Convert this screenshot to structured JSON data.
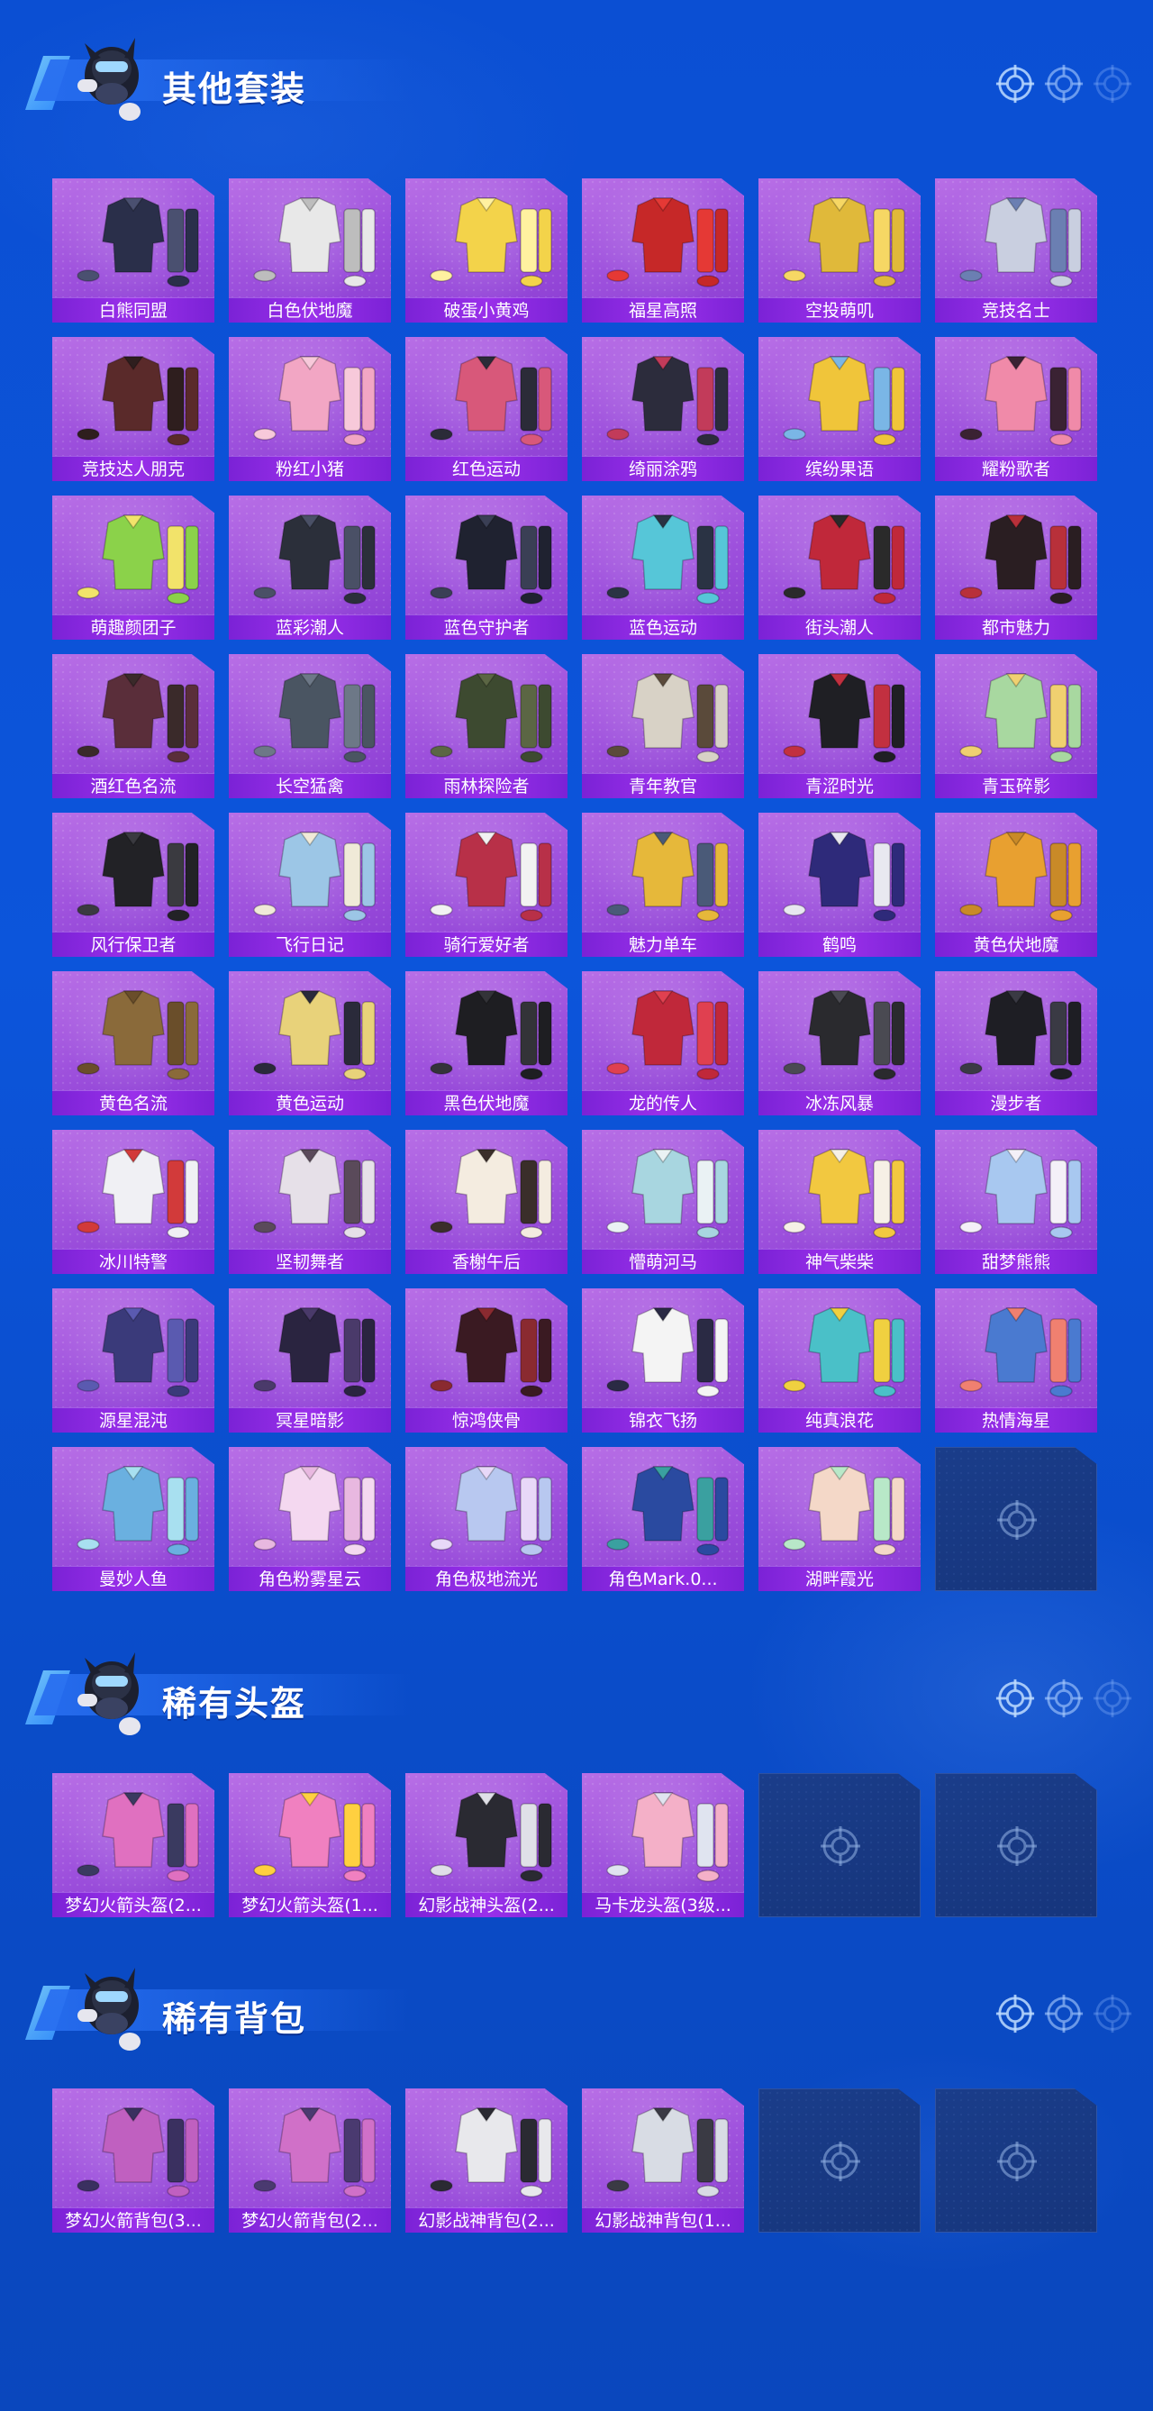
{
  "colors": {
    "page_bg": "#0d55d6",
    "card_purple": "#9c4fdc",
    "label_bar": "#8a2be2",
    "empty_slot": "#1a3d8a"
  },
  "sections": [
    {
      "title": "其他套装",
      "items": [
        {
          "label": "白熊同盟",
          "palette": [
            "#2a2f4a",
            "#4a5070"
          ]
        },
        {
          "label": "白色伏地魔",
          "palette": [
            "#e8e8e8",
            "#bdbdbd"
          ]
        },
        {
          "label": "破蛋小黄鸡",
          "palette": [
            "#f3d34a",
            "#fff1a0"
          ]
        },
        {
          "label": "福星高照",
          "palette": [
            "#c62828",
            "#e53935"
          ]
        },
        {
          "label": "空投萌叽",
          "palette": [
            "#e0b93a",
            "#f6d764"
          ]
        },
        {
          "label": "竞技名士",
          "palette": [
            "#c9cfe0",
            "#6b7fb2"
          ]
        },
        {
          "label": "竞技达人朋克",
          "palette": [
            "#5a2a2a",
            "#2e1e1e"
          ]
        },
        {
          "label": "粉红小猪",
          "palette": [
            "#f2a6c4",
            "#f7c9da"
          ]
        },
        {
          "label": "红色运动",
          "palette": [
            "#d8587a",
            "#2b2b38"
          ]
        },
        {
          "label": "绮丽涂鸦",
          "palette": [
            "#2c2c3c",
            "#c23b5a"
          ]
        },
        {
          "label": "缤纷果语",
          "palette": [
            "#f0c53a",
            "#7ab6e6"
          ]
        },
        {
          "label": "耀粉歌者",
          "palette": [
            "#f08aa9",
            "#3a2233"
          ]
        },
        {
          "label": "萌趣颜团子",
          "palette": [
            "#8bd24a",
            "#f2e36a"
          ]
        },
        {
          "label": "蓝彩潮人",
          "palette": [
            "#2b2f3a",
            "#4a5066"
          ]
        },
        {
          "label": "蓝色守护者",
          "palette": [
            "#1f2230",
            "#3a3f55"
          ]
        },
        {
          "label": "蓝色运动",
          "palette": [
            "#56c6d8",
            "#2a3344"
          ]
        },
        {
          "label": "街头潮人",
          "palette": [
            "#c0283a",
            "#2a2a2a"
          ]
        },
        {
          "label": "都市魅力",
          "palette": [
            "#2a1e22",
            "#b8303a"
          ]
        },
        {
          "label": "酒红色名流",
          "palette": [
            "#5a2e3a",
            "#3a2a2a"
          ]
        },
        {
          "label": "长空猛禽",
          "palette": [
            "#4a5562",
            "#6d7887"
          ]
        },
        {
          "label": "雨林探险者",
          "palette": [
            "#3d4a30",
            "#5b6644"
          ]
        },
        {
          "label": "青年教官",
          "palette": [
            "#d8d2c6",
            "#5a4a3a"
          ]
        },
        {
          "label": "青涩时光",
          "palette": [
            "#1f1f24",
            "#c23040"
          ]
        },
        {
          "label": "青玉碎影",
          "palette": [
            "#a8d8a0",
            "#f0d070"
          ]
        },
        {
          "label": "风行保卫者",
          "palette": [
            "#222226",
            "#3a3a40"
          ]
        },
        {
          "label": "飞行日记",
          "palette": [
            "#9cc6e6",
            "#f0ead8"
          ]
        },
        {
          "label": "骑行爱好者",
          "palette": [
            "#b83048",
            "#f2f2f2"
          ]
        },
        {
          "label": "魅力单车",
          "palette": [
            "#e6b83a",
            "#4a5a78"
          ]
        },
        {
          "label": "鹤鸣",
          "palette": [
            "#2e2a7a",
            "#e8e8f0"
          ]
        },
        {
          "label": "黄色伏地魔",
          "palette": [
            "#e8a030",
            "#c98a28"
          ]
        },
        {
          "label": "黄色名流",
          "palette": [
            "#8a6a3a",
            "#6a4e2a"
          ]
        },
        {
          "label": "黄色运动",
          "palette": [
            "#e8d27a",
            "#2a2a3a"
          ]
        },
        {
          "label": "黑色伏地魔",
          "palette": [
            "#1e1e22",
            "#333338"
          ]
        },
        {
          "label": "龙的传人",
          "palette": [
            "#c0283a",
            "#e04050"
          ]
        },
        {
          "label": "冰冻风暴",
          "palette": [
            "#2a2a2e",
            "#4a4a52"
          ]
        },
        {
          "label": "漫步者",
          "palette": [
            "#1e1e24",
            "#3a3a44"
          ]
        },
        {
          "label": "冰川特警",
          "palette": [
            "#f0f0f4",
            "#d23a3a"
          ]
        },
        {
          "label": "坚韧舞者",
          "palette": [
            "#e6e0e8",
            "#5a4a5a"
          ]
        },
        {
          "label": "香榭午后",
          "palette": [
            "#f4ece0",
            "#3a2e2a"
          ]
        },
        {
          "label": "懵萌河马",
          "palette": [
            "#a8d6e0",
            "#eaf2f4"
          ]
        },
        {
          "label": "神气柴柴",
          "palette": [
            "#f2c840",
            "#f6f0e6"
          ]
        },
        {
          "label": "甜梦熊熊",
          "palette": [
            "#a8c8f0",
            "#f4f0f8"
          ]
        },
        {
          "label": "源星混沌",
          "palette": [
            "#3a3a7a",
            "#5a5ab0"
          ]
        },
        {
          "label": "冥星暗影",
          "palette": [
            "#2a2440",
            "#4a3a6a"
          ]
        },
        {
          "label": "惊鸿侠骨",
          "palette": [
            "#3a1a22",
            "#8a2a30"
          ]
        },
        {
          "label": "锦衣飞扬",
          "palette": [
            "#f4f4f4",
            "#2a2a44"
          ]
        },
        {
          "label": "纯真浪花",
          "palette": [
            "#4ac0c8",
            "#f0d040"
          ]
        },
        {
          "label": "热情海星",
          "palette": [
            "#4a7ad0",
            "#f08070"
          ]
        },
        {
          "label": "曼妙人鱼",
          "palette": [
            "#6ab0e0",
            "#a8e0f0"
          ]
        },
        {
          "label": "角色粉雾星云",
          "palette": [
            "#f4d8f0",
            "#e8b8e0"
          ]
        },
        {
          "label": "角色极地流光",
          "palette": [
            "#b8c8f0",
            "#e8d8f8"
          ]
        },
        {
          "label": "角色Mark.0...",
          "palette": [
            "#2a4aa0",
            "#3aa0a0"
          ]
        },
        {
          "label": "湖畔霞光",
          "palette": [
            "#f4d8c8",
            "#b8e8c8"
          ]
        },
        {
          "label": "",
          "empty": true
        }
      ]
    },
    {
      "title": "稀有头盔",
      "items": [
        {
          "label": "梦幻火箭头盔(2...",
          "palette": [
            "#e070c0",
            "#3a3a60"
          ]
        },
        {
          "label": "梦幻火箭头盔(1...",
          "palette": [
            "#f080c0",
            "#ffd040"
          ]
        },
        {
          "label": "幻影战神头盔(2...",
          "palette": [
            "#2a2a32",
            "#e0e0e8"
          ]
        },
        {
          "label": "马卡龙头盔(3级...",
          "palette": [
            "#f4b0c8",
            "#e0e4f0"
          ]
        },
        {
          "label": "",
          "empty": true
        },
        {
          "label": "",
          "empty": true
        }
      ]
    },
    {
      "title": "稀有背包",
      "items": [
        {
          "label": "梦幻火箭背包(3...",
          "palette": [
            "#c060c0",
            "#3a3060"
          ]
        },
        {
          "label": "梦幻火箭背包(2...",
          "palette": [
            "#d070c8",
            "#4a3a70"
          ]
        },
        {
          "label": "幻影战神背包(2...",
          "palette": [
            "#e8e8ec",
            "#2a2a32"
          ]
        },
        {
          "label": "幻影战神背包(1...",
          "palette": [
            "#d8dce4",
            "#3a3a44"
          ]
        },
        {
          "label": "",
          "empty": true
        },
        {
          "label": "",
          "empty": true
        }
      ]
    }
  ]
}
